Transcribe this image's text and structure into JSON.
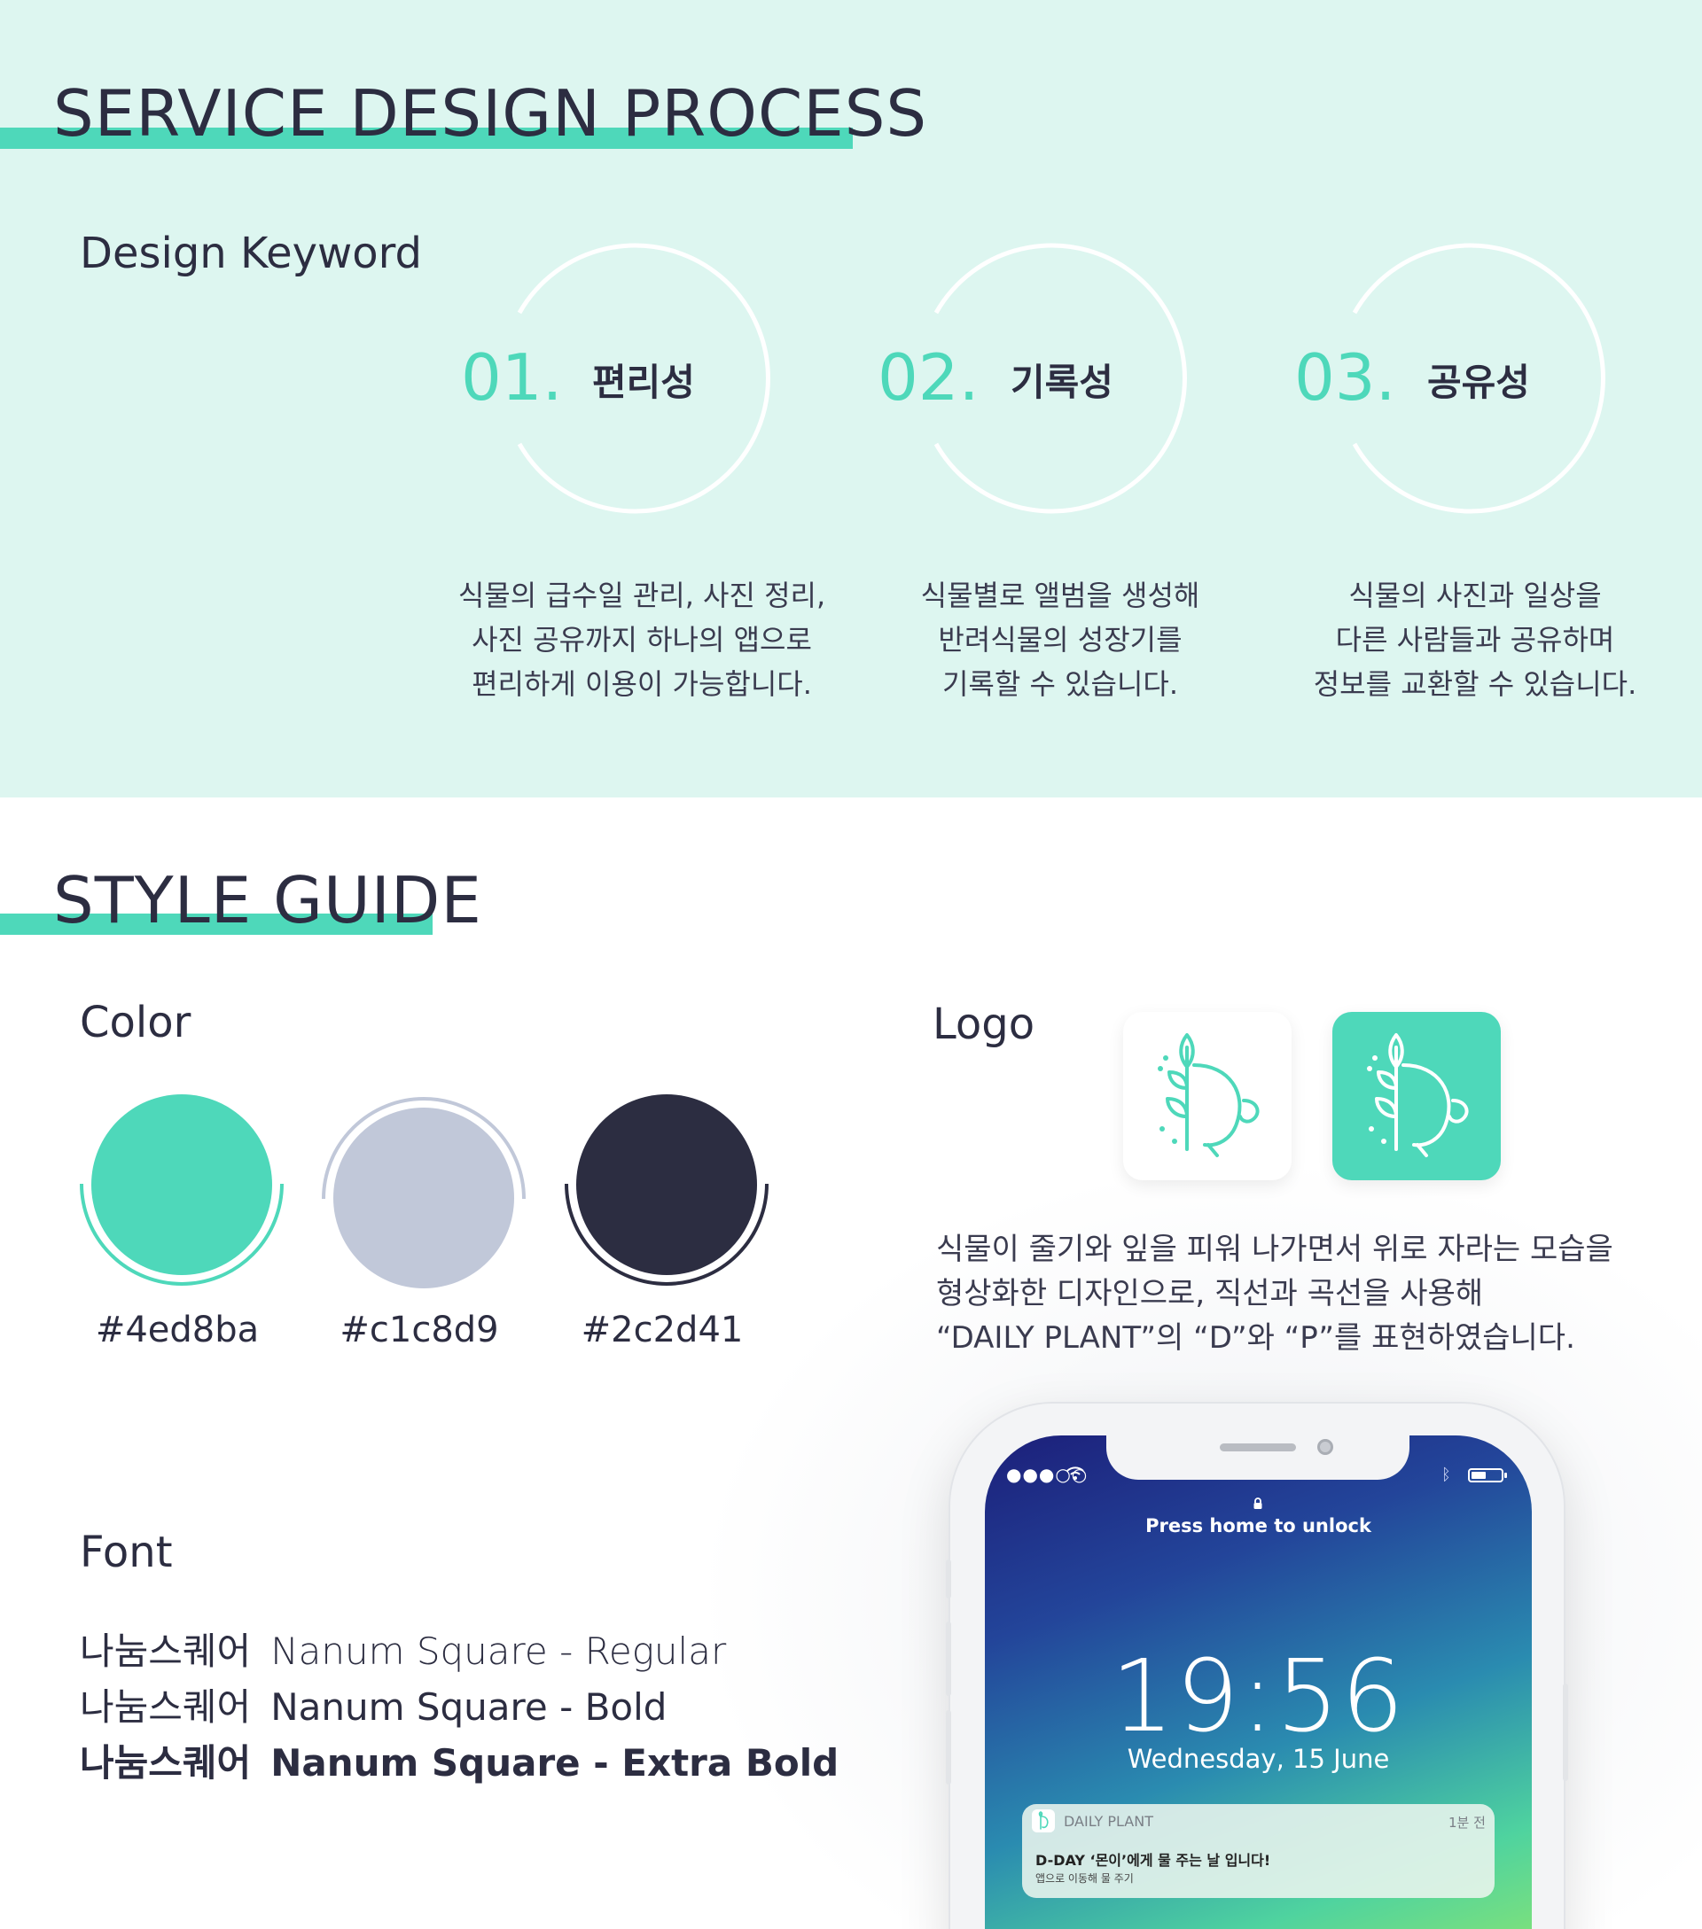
{
  "process": {
    "title": "SERVICE DESIGN PROCESS",
    "subhead": "Design Keyword",
    "keywords": [
      {
        "num": "01.",
        "label": "편리성",
        "desc": [
          "식물의 급수일 관리, 사진 정리,",
          "사진 공유까지 하나의 앱으로",
          "편리하게 이용이 가능합니다."
        ]
      },
      {
        "num": "02.",
        "label": "기록성",
        "desc": [
          "식물별로 앨범을 생성해",
          "반려식물의 성장기를",
          "기록할 수 있습니다."
        ]
      },
      {
        "num": "03.",
        "label": "공유성",
        "desc": [
          "식물의 사진과 일상을",
          "다른 사람들과 공유하며",
          "정보를 교환할 수 있습니다."
        ]
      }
    ]
  },
  "style": {
    "title": "STYLE GUIDE",
    "color_head": "Color",
    "colors": [
      {
        "hex": "#4ed8ba",
        "color": "#4ed8ba"
      },
      {
        "hex": "#c1c8d9",
        "color": "#c1c8d9"
      },
      {
        "hex": "#2c2d41",
        "color": "#2c2d41"
      }
    ],
    "font_head": "Font",
    "fonts": [
      {
        "kr": "나눔스퀘어",
        "en": "Nanum Square - Regular"
      },
      {
        "kr": "나눔스퀘어",
        "en": "Nanum Square - Bold"
      },
      {
        "kr": "나눔스퀘어",
        "en": "Nanum Square - Extra Bold"
      }
    ],
    "logo_head": "Logo",
    "logo_desc": [
      "식물이 줄기와 잎을 피워 나가면서 위로 자라는 모습을",
      "형상화한 디자인으로, 직선과 곡선을 사용해",
      "“DAILY PLANT”의 “D”와 “P”를 표현하였습니다."
    ]
  },
  "phone": {
    "signal": "●●●○○",
    "unlock": "Press home to unlock",
    "time": "19:56",
    "date": "Wednesday, 15 June",
    "notification": {
      "app": "DAILY PLANT",
      "time": "1분 전",
      "title": "D-DAY  ‘몬이’에게 물 주는 날 입니다!",
      "body": "앱으로 이동해 물 주기"
    }
  }
}
